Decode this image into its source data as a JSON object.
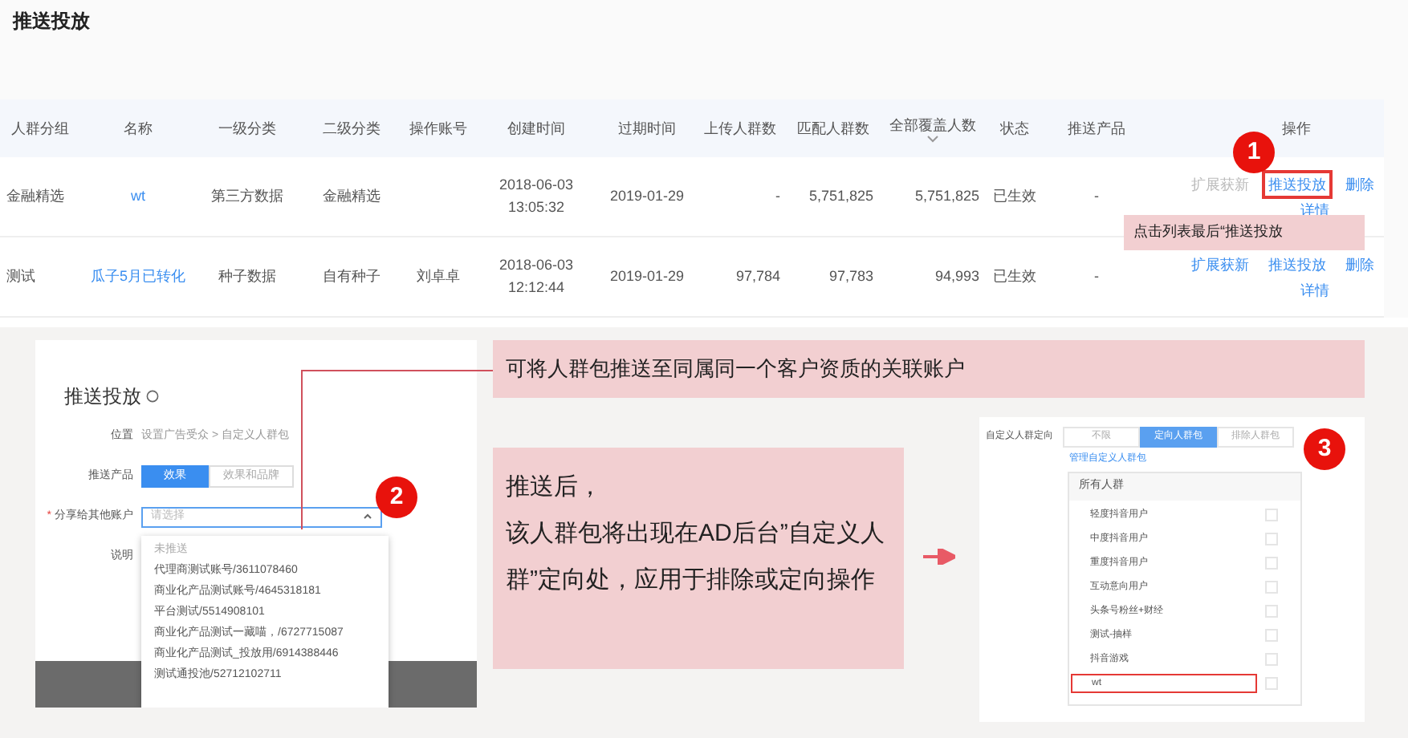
{
  "page_title": "推送投放",
  "table": {
    "columns": [
      {
        "label": "人群分组",
        "sorted": false
      },
      {
        "label": "名称",
        "sorted": false
      },
      {
        "label": "一级分类",
        "sorted": false
      },
      {
        "label": "二级分类",
        "sorted": false
      },
      {
        "label": "操作账号",
        "sorted": false
      },
      {
        "label": "创建时间",
        "sorted": false
      },
      {
        "label": "过期时间",
        "sorted": false
      },
      {
        "label": "上传人群数",
        "sorted": false
      },
      {
        "label": "匹配人群数",
        "sorted": false
      },
      {
        "label": "全部覆盖人数",
        "sorted": true
      },
      {
        "label": "状态",
        "sorted": false
      },
      {
        "label": "推送产品",
        "sorted": false
      },
      {
        "label": "操作",
        "sorted": false
      }
    ],
    "rows": [
      {
        "cells": [
          "金融精选",
          "wt",
          "第三方数据",
          "金融精选",
          null,
          "2018-06-03 13:05:32",
          "2019-01-29",
          "-",
          "5,751,825",
          "5,751,825",
          "已生效",
          "-"
        ],
        "actions": [
          {
            "label": "扩展获新",
            "disabled": true,
            "highlighted": false
          },
          {
            "label": "推送投放",
            "disabled": false,
            "highlighted": true
          },
          {
            "label": "删除",
            "disabled": false,
            "highlighted": false
          },
          {
            "label": "详情",
            "disabled": false,
            "highlighted": false
          }
        ]
      },
      {
        "cells": [
          "测试",
          "瓜子5月已转化",
          "种子数据",
          "自有种子",
          "刘卓卓",
          "2018-06-03 12:12:44",
          "2019-01-29",
          "97,784",
          "97,783",
          "94,993",
          "已生效",
          "-"
        ],
        "actions": [
          {
            "label": "扩展获新",
            "disabled": false,
            "highlighted": false
          },
          {
            "label": "推送投放",
            "disabled": false,
            "highlighted": false
          },
          {
            "label": "删除",
            "disabled": false,
            "highlighted": false
          },
          {
            "label": "详情",
            "disabled": false,
            "highlighted": false
          }
        ]
      }
    ]
  },
  "step_1": {
    "badge": "1",
    "note": "点击列表最后“推送投放"
  },
  "push_dialog": {
    "title": "推送投放",
    "fields": [
      {
        "kind": "text",
        "label": "位置",
        "value": "设置广告受众 > 自定义人群包"
      },
      {
        "kind": "segmented",
        "label": "推送产品",
        "options": [
          {
            "label": "效果",
            "selected": true
          },
          {
            "label": "效果和品牌",
            "selected": false
          }
        ]
      },
      {
        "kind": "select",
        "label": "分享给其他账户",
        "required_mark": "*",
        "placeholder": "请选择",
        "expanded": true
      },
      {
        "kind": "text",
        "label": "说明"
      }
    ],
    "dropdown": {
      "group": "未推送",
      "options": [
        "代理商测试账号/3611078460",
        "商业化产品测试账号/4645318181",
        "平台测试/5514908101",
        "商业化产品测试一藏喵，/6727715087",
        "商业化产品测试_投放用/6914388446",
        "测试通投池/52712102711"
      ]
    },
    "badge": "2"
  },
  "callouts": {
    "share_note": "可将人群包推送至同属同一个客户资质的关联账户",
    "result_note": [
      "推送后，",
      "该人群包将出现在AD后台”自定义人群”定向处，应用于排除或定向操作"
    ]
  },
  "targeting_panel": {
    "label": "自定义人群定向",
    "options": [
      {
        "label": "不限",
        "selected": false
      },
      {
        "label": "定向人群包",
        "selected": true
      },
      {
        "label": "排除人群包",
        "selected": false
      }
    ],
    "manage_link": "管理自定义人群包",
    "list_header": "所有人群",
    "items": [
      {
        "label": "轻度抖音用户",
        "checked": false,
        "highlighted": false
      },
      {
        "label": "中度抖音用户",
        "checked": false,
        "highlighted": false
      },
      {
        "label": "重度抖音用户",
        "checked": false,
        "highlighted": false
      },
      {
        "label": "互动意向用户",
        "checked": false,
        "highlighted": false
      },
      {
        "label": "头条号粉丝+财经",
        "checked": false,
        "highlighted": false
      },
      {
        "label": "测试-抽样",
        "checked": false,
        "highlighted": false
      },
      {
        "label": "抖音游戏",
        "checked": false,
        "highlighted": false
      },
      {
        "label": "wt",
        "checked": false,
        "highlighted": true
      }
    ],
    "badge": "3"
  }
}
